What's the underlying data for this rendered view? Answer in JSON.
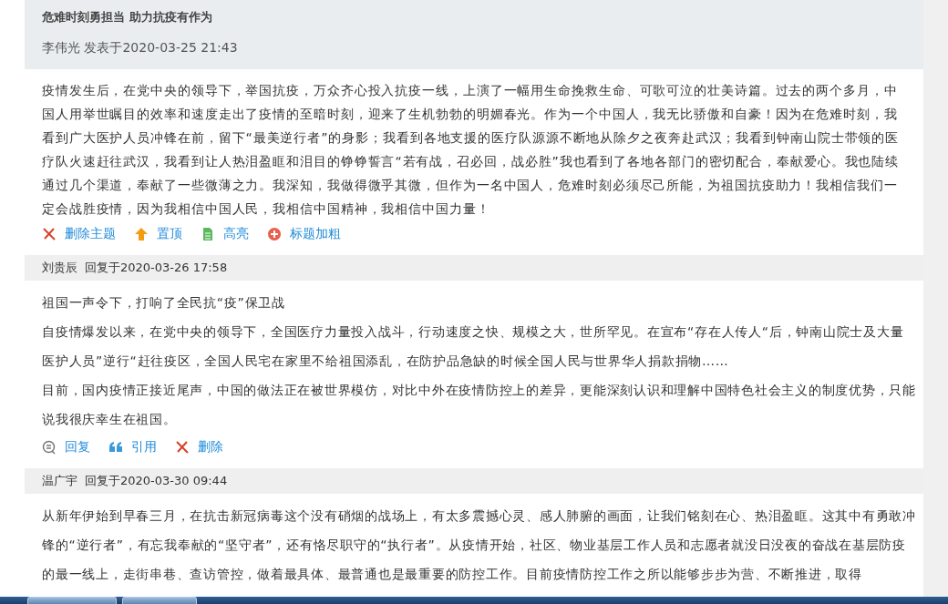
{
  "thread": {
    "title": "危难时刻勇担当 助力抗疫有作为",
    "byline": "李伟光 发表于2020-03-25 21:43",
    "body": "疫情发生后，在党中央的领导下，举国抗疫，万众齐心投入抗疫一线，上演了一幅用生命挽救生命、可歌可泣的壮美诗篇。过去的两个多月，中国人用举世瞩目的效率和速度走出了疫情的至暗时刻，迎来了生机勃勃的明媚春光。作为一个中国人，我无比骄傲和自豪！因为在危难时刻，我看到广大医护人员冲锋在前，留下“最美逆行者”的身影；我看到各地支援的医疗队源源不断地从除夕之夜奔赴武汉；我看到钟南山院士带领的医疗队火速赶往武汉，我看到让人热泪盈眶和泪目的铮铮誓言“若有战，召必回，战必胜”我也看到了各地各部门的密切配合，奉献爱心。我也陆续通过几个渠道，奉献了一些微薄之力。我深知，我做得微乎其微，但作为一名中国人，危难时刻必须尽己所能，为祖国抗疫助力！我相信我们一定会战胜疫情，因为我相信中国人民，我相信中国精神，我相信中国力量！",
    "actions": [
      {
        "kind": "delete",
        "label": "删除主题"
      },
      {
        "kind": "pin",
        "label": "置顶"
      },
      {
        "kind": "highlight",
        "label": "高亮"
      },
      {
        "kind": "bold",
        "label": "标题加粗"
      }
    ]
  },
  "replies": [
    {
      "author": "刘贵辰",
      "time": "回复于2020-03-26 17:58",
      "paragraphs": [
        "祖国一声令下，打响了全民抗“疫”保卫战",
        "自疫情爆发以来，在党中央的领导下，全国医疗力量投入战斗，行动速度之快、规模之大，世所罕见。在宣布“存在人传人“后，钟南山院士及大量医护人员”逆行“赶往疫区，全国人民宅在家里不给祖国添乱，在防护品急缺的时候全国人民与世界华人捐款捐物……",
        "目前，国内疫情正接近尾声，中国的做法正在被世界模仿，对比中外在疫情防控上的差异，更能深刻认识和理解中国特色社会主义的制度优势，只能说我很庆幸生在祖国。"
      ],
      "actions": [
        {
          "kind": "reply",
          "label": "回复"
        },
        {
          "kind": "quote",
          "label": "引用"
        },
        {
          "kind": "delete",
          "label": "删除"
        }
      ]
    },
    {
      "author": "温广宇",
      "time": "回复于2020-03-30 09:44",
      "paragraphs": [
        "从新年伊始到早春三月，在抗击新冠病毒这个没有硝烟的战场上，有太多震撼心灵、感人肺腑的画面，让我们铭刻在心、热泪盈眶。这其中有勇敢冲锋的“逆行者”，有忘我奉献的“坚守者”，还有恪尽职守的“执行者”。从疫情开始，社区、物业基层工作人员和志愿者就没日没夜的奋战在基层防疫的最一线上，走街串巷、查访管控，做着最具体、最普通也是最重要的防控工作。目前疫情防控工作之所以能够步步为营、不断推进，取得"
      ]
    }
  ]
}
